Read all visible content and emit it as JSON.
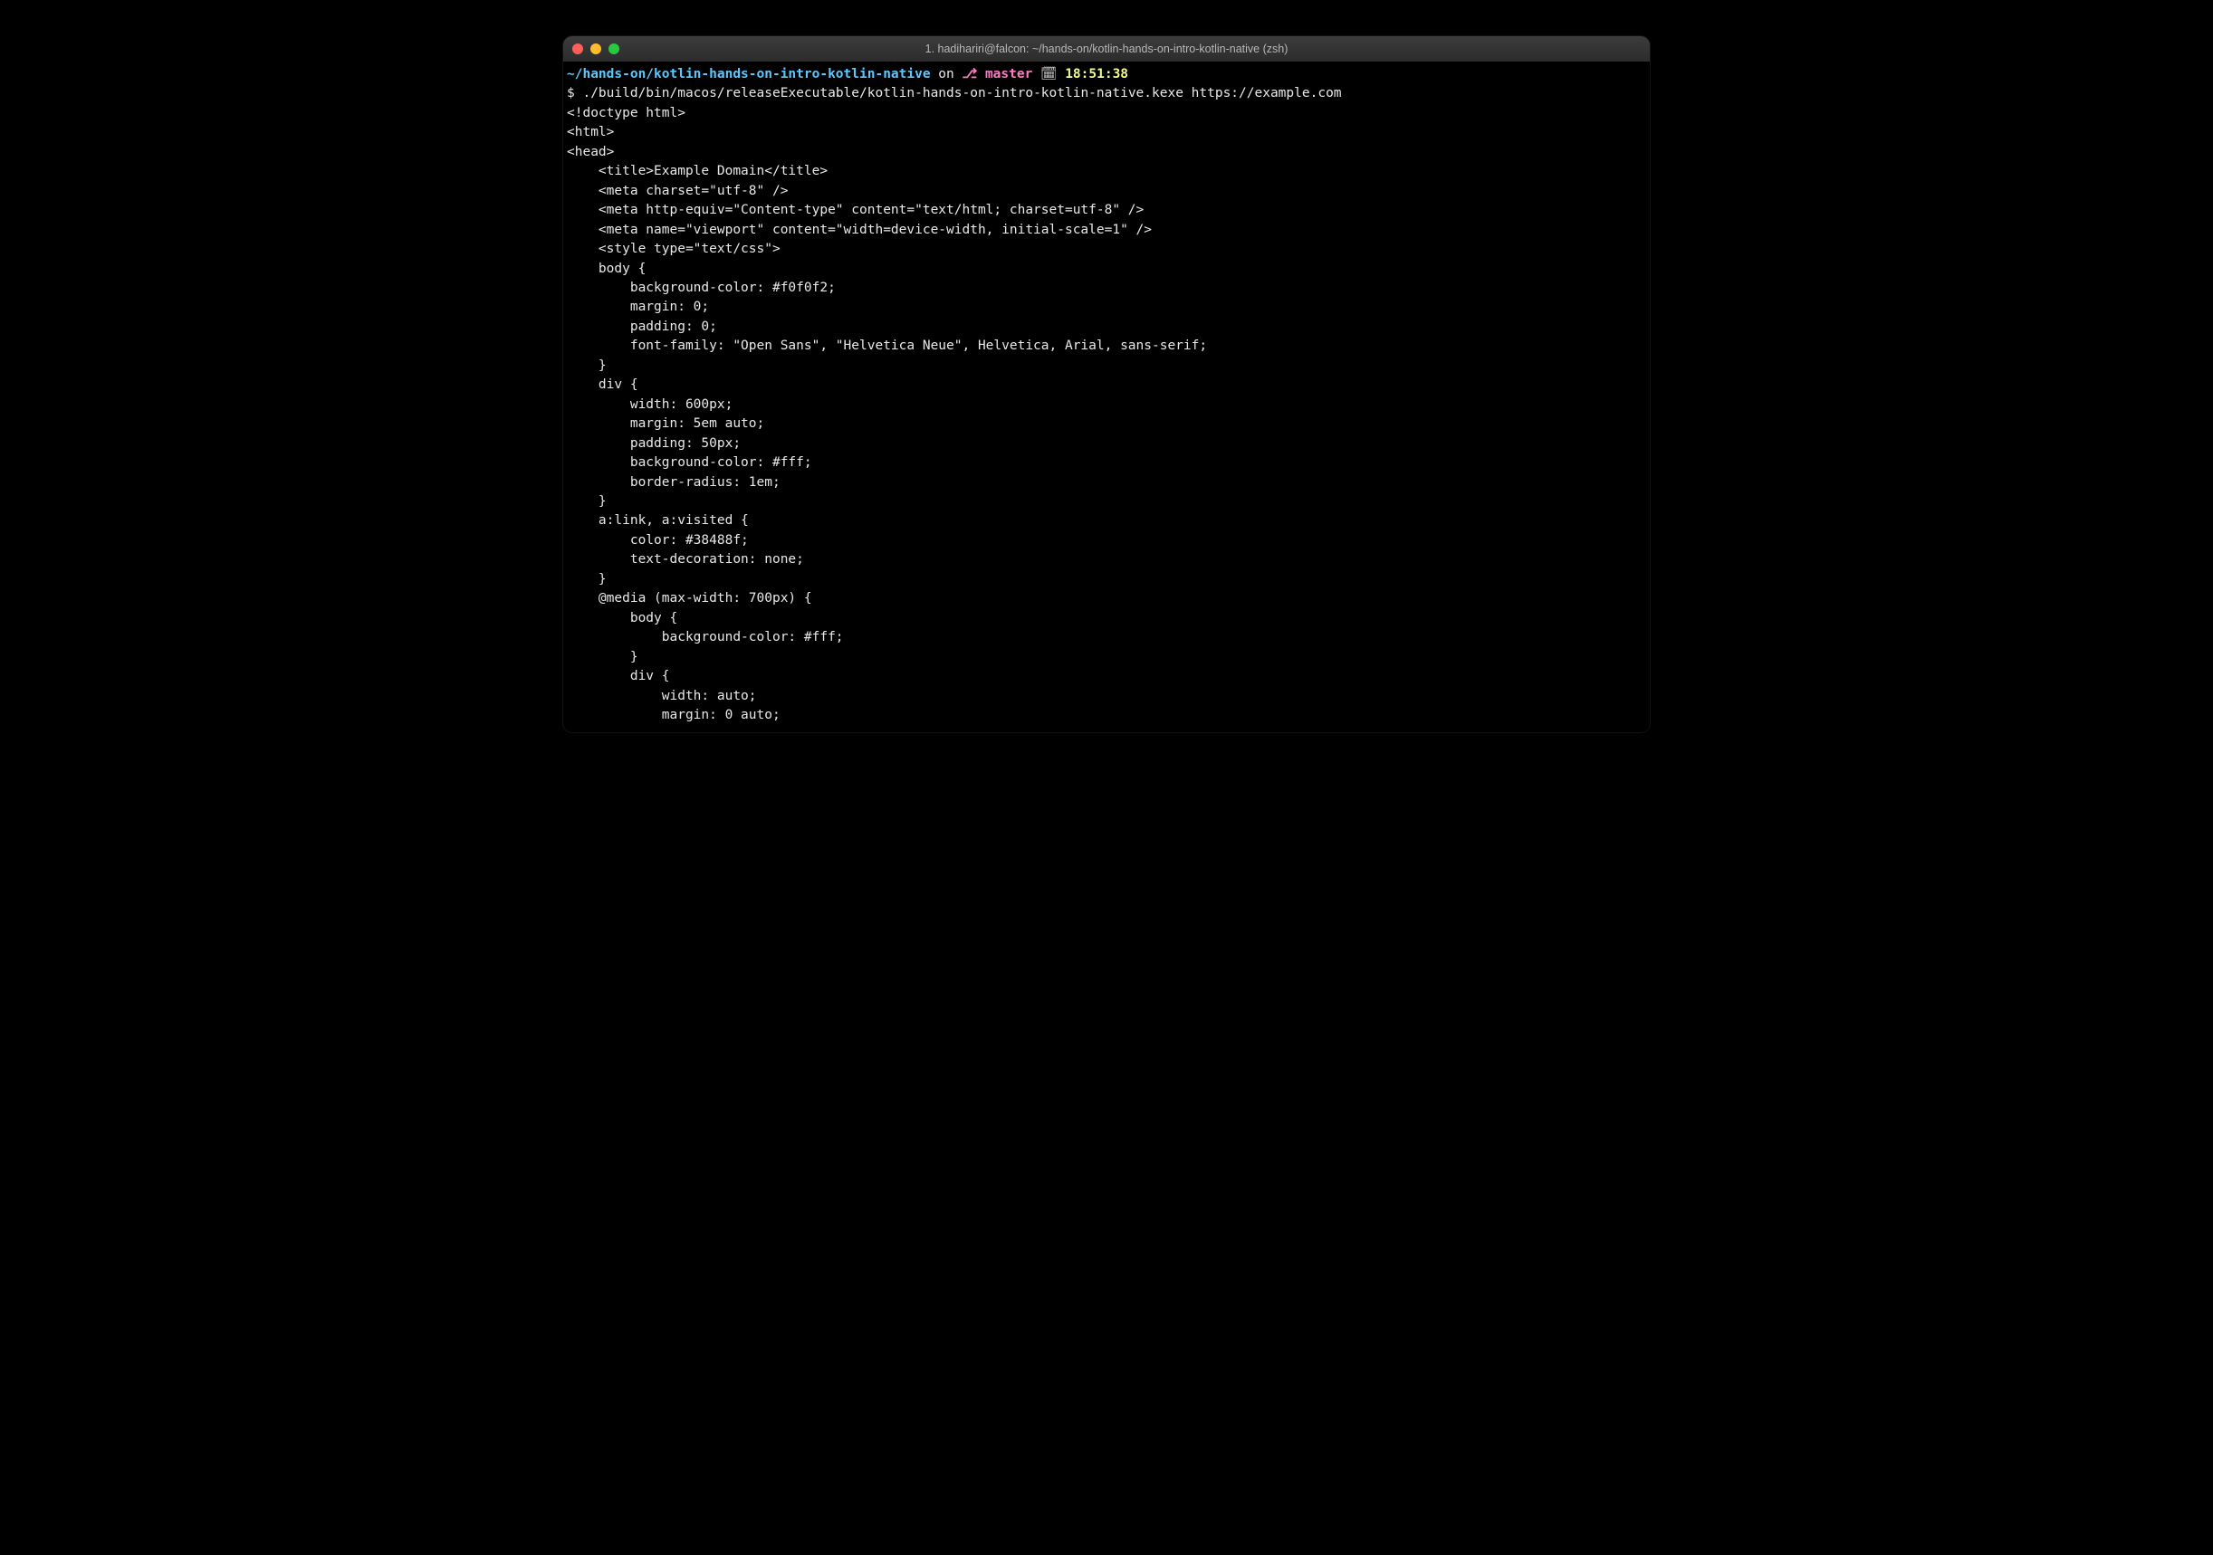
{
  "window": {
    "title": "1. hadihariri@falcon: ~/hands-on/kotlin-hands-on-intro-kotlin-native (zsh)"
  },
  "prompt": {
    "path": "~/hands-on/kotlin-hands-on-intro-kotlin-native",
    "on": " on ",
    "branch_icon": "⎇",
    "branch": " master",
    "time_icon": " 🗓 ",
    "time": "18:51:38"
  },
  "command": {
    "prompt_symbol": "$ ",
    "text": "./build/bin/macos/releaseExecutable/kotlin-hands-on-intro-kotlin-native.kexe https://example.com"
  },
  "output": {
    "l0": "<!doctype html>",
    "l1": "<html>",
    "l2": "<head>",
    "l3": "    <title>Example Domain</title>",
    "l4": "",
    "l5": "    <meta charset=\"utf-8\" />",
    "l6": "    <meta http-equiv=\"Content-type\" content=\"text/html; charset=utf-8\" />",
    "l7": "    <meta name=\"viewport\" content=\"width=device-width, initial-scale=1\" />",
    "l8": "    <style type=\"text/css\">",
    "l9": "    body {",
    "l10": "        background-color: #f0f0f2;",
    "l11": "        margin: 0;",
    "l12": "        padding: 0;",
    "l13": "        font-family: \"Open Sans\", \"Helvetica Neue\", Helvetica, Arial, sans-serif;",
    "l14": "",
    "l15": "    }",
    "l16": "    div {",
    "l17": "        width: 600px;",
    "l18": "        margin: 5em auto;",
    "l19": "        padding: 50px;",
    "l20": "        background-color: #fff;",
    "l21": "        border-radius: 1em;",
    "l22": "    }",
    "l23": "    a:link, a:visited {",
    "l24": "        color: #38488f;",
    "l25": "        text-decoration: none;",
    "l26": "    }",
    "l27": "    @media (max-width: 700px) {",
    "l28": "        body {",
    "l29": "            background-color: #fff;",
    "l30": "        }",
    "l31": "        div {",
    "l32": "            width: auto;",
    "l33": "            margin: 0 auto;"
  }
}
